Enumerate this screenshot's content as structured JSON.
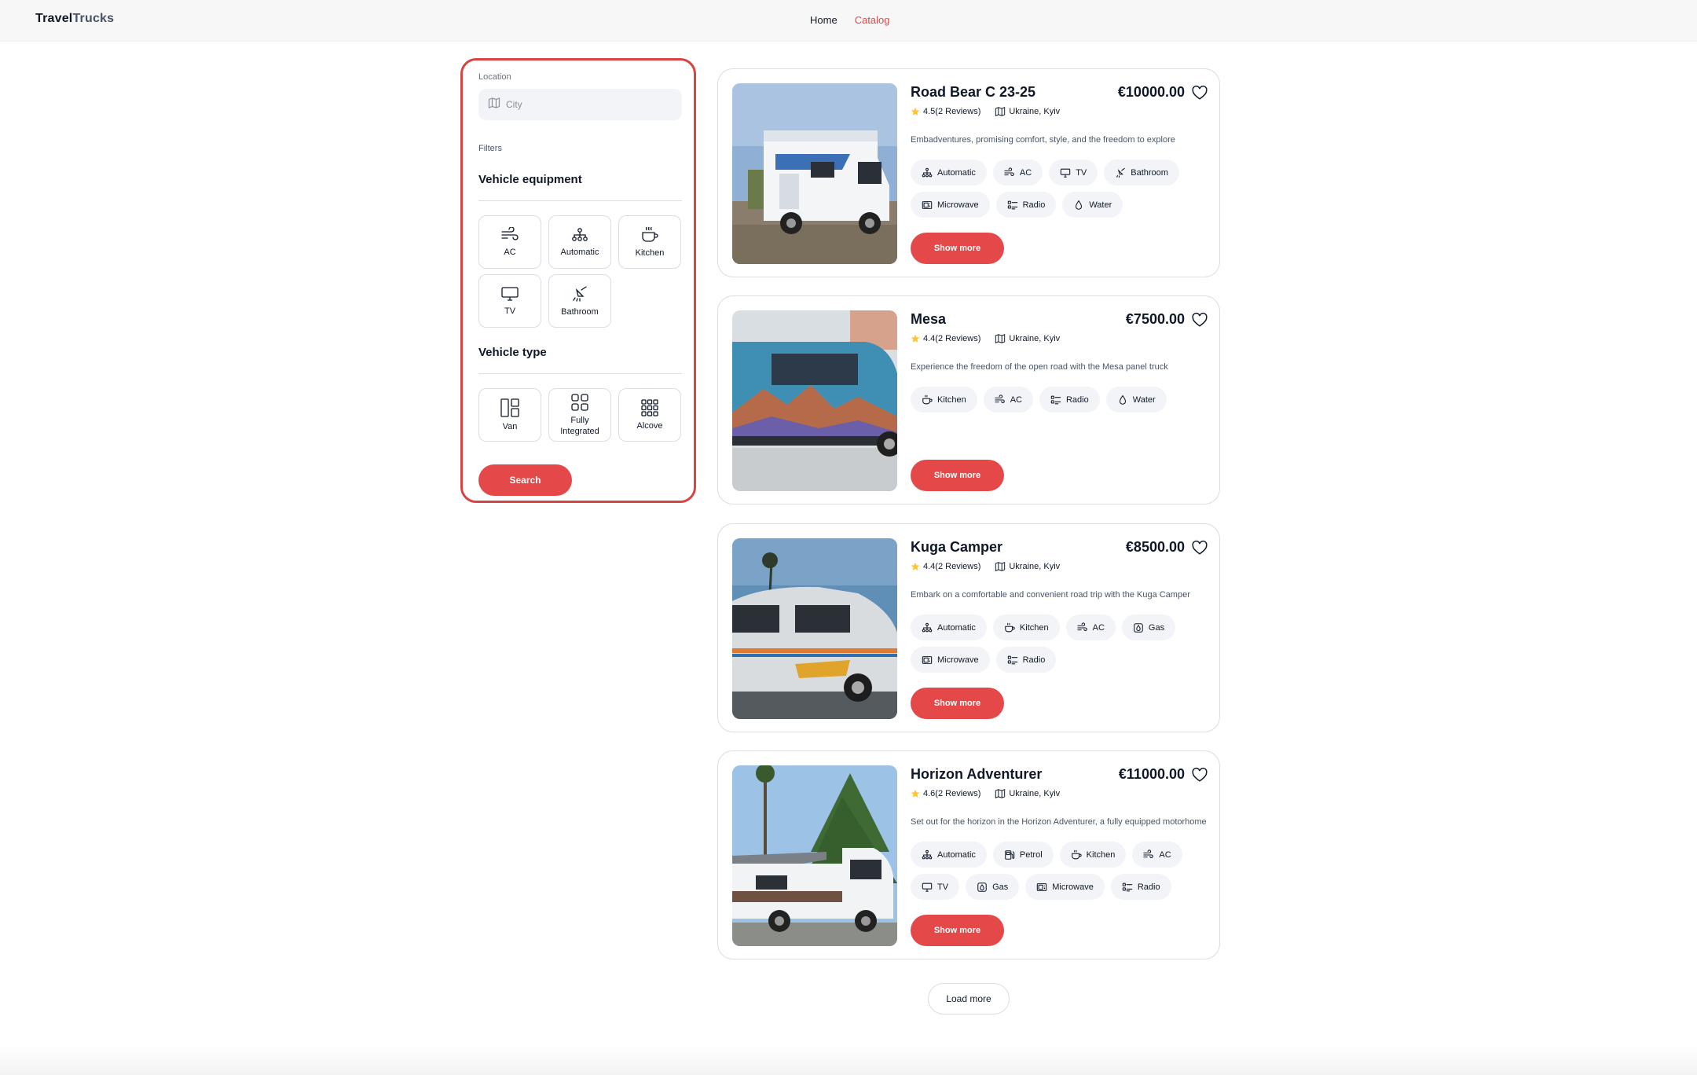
{
  "header": {
    "logo_a": "Travel",
    "logo_b": "Trucks",
    "nav": [
      {
        "label": "Home"
      },
      {
        "label": "Catalog"
      }
    ]
  },
  "filters": {
    "location_label": "Location",
    "location_placeholder": "City",
    "filters_label": "Filters",
    "equipment_title": "Vehicle equipment",
    "equipment": [
      {
        "label": "AC",
        "icon": "ac-icon"
      },
      {
        "label": "Automatic",
        "icon": "automatic-icon"
      },
      {
        "label": "Kitchen",
        "icon": "kitchen-icon"
      },
      {
        "label": "TV",
        "icon": "tv-icon"
      },
      {
        "label": "Bathroom",
        "icon": "bathroom-icon"
      }
    ],
    "type_title": "Vehicle type",
    "types": [
      {
        "label": "Van",
        "icon": "van-icon"
      },
      {
        "label_line1": "Fully",
        "label_line2": "Integrated",
        "icon": "fully-integrated-icon"
      },
      {
        "label": "Alcove",
        "icon": "alcove-icon"
      }
    ],
    "search_label": "Search"
  },
  "campers": [
    {
      "name": "Road Bear C 23-25",
      "price": "€10000.00",
      "rating": "4.5(2 Reviews)",
      "location": "Ukraine, Kyiv",
      "description": "Embadventures, promising comfort, style, and the freedom to explore",
      "chips": [
        "Automatic",
        "AC",
        "TV",
        "Bathroom",
        "Microwave",
        "Radio",
        "Water"
      ]
    },
    {
      "name": "Mesa",
      "price": "€7500.00",
      "rating": "4.4(2 Reviews)",
      "location": "Ukraine, Kyiv",
      "description": "Experience the freedom of the open road with the Mesa panel truck",
      "chips": [
        "Kitchen",
        "AC",
        "Radio",
        "Water"
      ]
    },
    {
      "name": "Kuga Camper",
      "price": "€8500.00",
      "rating": "4.4(2 Reviews)",
      "location": "Ukraine, Kyiv",
      "description": "Embark on a comfortable and convenient road trip with the Kuga Camper",
      "chips": [
        "Automatic",
        "Kitchen",
        "AC",
        "Gas",
        "Microwave",
        "Radio"
      ]
    },
    {
      "name": "Horizon Adventurer",
      "price": "€11000.00",
      "rating": "4.6(2 Reviews)",
      "location": "Ukraine, Kyiv",
      "description": "Set out for the horizon in the Horizon Adventurer, a fully equipped motorhome",
      "chips": [
        "Automatic",
        "Petrol",
        "Kitchen",
        "AC",
        "TV",
        "Gas",
        "Microwave",
        "Radio"
      ]
    }
  ],
  "show_more_label": "Show more",
  "load_more_label": "Load more",
  "colors": {
    "accent": "#e44848",
    "star": "#ffc531",
    "chip_bg": "#f2f4f7",
    "border": "#dadde1"
  }
}
